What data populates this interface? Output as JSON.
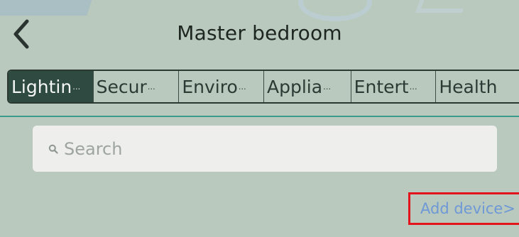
{
  "header": {
    "title": "Master bedroom",
    "back_icon": "chevron-left-icon"
  },
  "tabs": [
    {
      "label": "Lightin",
      "truncated": true,
      "active": true
    },
    {
      "label": "Secur",
      "truncated": true,
      "active": false
    },
    {
      "label": "Enviro",
      "truncated": true,
      "active": false
    },
    {
      "label": "Applia",
      "truncated": true,
      "active": false
    },
    {
      "label": "Entert",
      "truncated": true,
      "active": false
    },
    {
      "label": "Health",
      "truncated": false,
      "active": false
    }
  ],
  "tab_ellipsis": "…",
  "search": {
    "placeholder": "Search",
    "icon": "search-icon"
  },
  "add_device": {
    "label": "Add device>"
  },
  "colors": {
    "background": "#b9c9bd",
    "active_tab": "#2f4b41",
    "divider": "#3a9b8c",
    "link": "#6e98d6",
    "highlight_box": "#e3141b"
  }
}
